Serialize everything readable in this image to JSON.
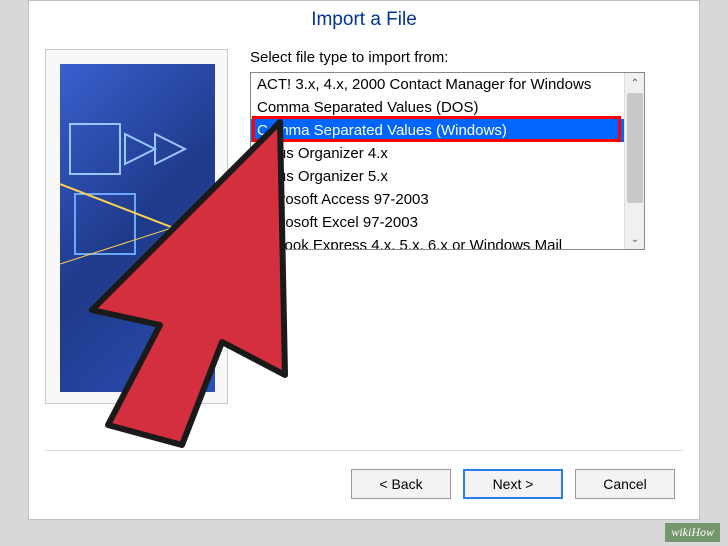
{
  "dialog": {
    "title": "Import a File",
    "prompt": "Select file type to import from:"
  },
  "filetypes": {
    "items": [
      "ACT! 3.x, 4.x, 2000 Contact Manager for Windows",
      "Comma Separated Values (DOS)",
      "Comma Separated Values (Windows)",
      "Lotus Organizer 4.x",
      "Lotus Organizer 5.x",
      "Microsoft Access 97-2003",
      "Microsoft Excel 97-2003",
      "Outlook Express 4.x, 5.x, 6.x or Windows Mail"
    ],
    "selected_index": 2
  },
  "buttons": {
    "back": "< Back",
    "next": "Next >",
    "cancel": "Cancel"
  },
  "scroll": {
    "up_glyph": "⌃",
    "down_glyph": "⌄"
  },
  "watermark": "wikiHow"
}
